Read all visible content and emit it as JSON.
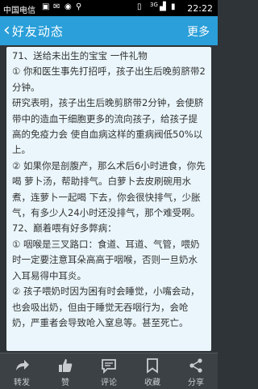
{
  "status_bar": {
    "carrier": "中国电信",
    "time": "22:22",
    "network": "3G"
  },
  "header": {
    "back_label": "好友动态",
    "more_label": "更多"
  },
  "content": {
    "paragraphs": [
      "71、送给未出生的宝宝 一件礼物",
      "① 你和医生事先打招呼，孩子出生后晚剪脐带2分钟。",
      "研究表明，孩子出生后晚剪脐带2分钟，会使脐带中的造血干细胞更多的流向孩子，给孩子提高的免疫力会 使自血病这样的重病阀低50%以上。",
      "② 如果你是剖腹产，那么术后6小时进食，你先喝 萝卜汤，帮助排气。白萝卜去皮刷碗用水煮，连萝卜一起喝 下去，你会很快排气，少胀气，有多少人24小时还没排气，那个难受啊。",
      "72、巅着喂有好多弊病：",
      "① 咽喉是三叉路口：食道、耳道、气管，喂奶时一定要注意耳朵高高于咽喉，否则一旦奶水入耳易得中耳炎。",
      "② 孩子喂奶时因为困有时会睡觉，小嘴会动，也会吸出奶，但由于睡觉无吞咽行为，会呛奶，严重者会导致呛入窒息等。甚至死亡。"
    ]
  },
  "tab_bar": {
    "items": [
      {
        "label": "转发",
        "icon": "share-icon"
      },
      {
        "label": "赞",
        "icon": "thumbs-up-icon"
      },
      {
        "label": "评论",
        "icon": "comment-icon"
      },
      {
        "label": "收藏",
        "icon": "bookmark-icon"
      },
      {
        "label": "分享",
        "icon": "share-network-icon"
      }
    ]
  },
  "colors": {
    "header": "#2a9fd9",
    "tab_bar": "#3b4145",
    "content_bg": "#eaf6fb"
  }
}
